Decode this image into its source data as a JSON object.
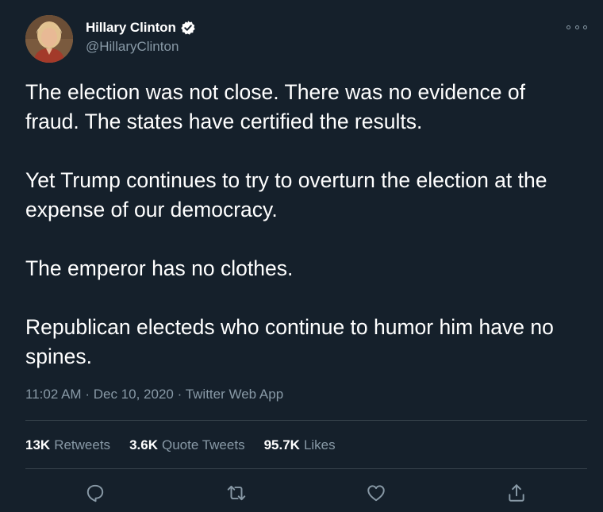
{
  "author": {
    "display_name": "Hillary Clinton",
    "handle": "@HillaryClinton",
    "verified": true,
    "avatar_icon": "profile-photo"
  },
  "tweet": {
    "paragraphs": [
      "The election was not close. There was no evidence of fraud. The states have certified the results.",
      "Yet Trump continues to try to overturn the election at the expense of our democracy.",
      "The emperor has no clothes.",
      "Republican electeds who continue to humor him have no spines."
    ],
    "time": "11:02 AM",
    "separator": "·",
    "date": "Dec 10, 2020",
    "source": "Twitter Web App"
  },
  "stats": {
    "retweets_count": "13K",
    "retweets_label": "Retweets",
    "quotes_count": "3.6K",
    "quotes_label": "Quote Tweets",
    "likes_count": "95.7K",
    "likes_label": "Likes"
  },
  "actions": [
    "reply-icon",
    "retweet-icon",
    "like-icon",
    "share-icon"
  ],
  "colors": {
    "background": "#15202b",
    "text": "#ffffff",
    "secondary_text": "#8899a6",
    "divider": "#38444d"
  }
}
